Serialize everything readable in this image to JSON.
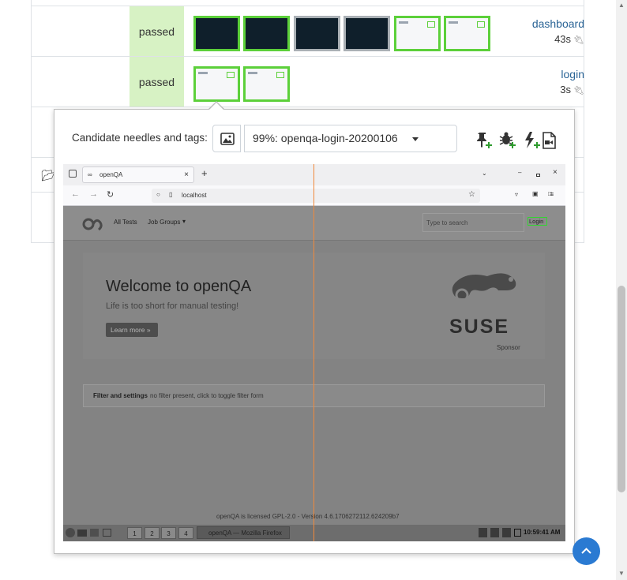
{
  "modules": [
    {
      "name": "dashboard",
      "time": "43s",
      "result": "passed",
      "thumbs": [
        {
          "variant": "dark",
          "border": "green"
        },
        {
          "variant": "dark",
          "border": "green"
        },
        {
          "variant": "dark",
          "border": "gray"
        },
        {
          "variant": "dark",
          "border": "gray"
        },
        {
          "variant": "light",
          "border": "green"
        },
        {
          "variant": "light",
          "border": "green"
        }
      ]
    },
    {
      "name": "login",
      "time": "3s",
      "result": "passed",
      "thumbs": [
        {
          "variant": "light",
          "border": "green"
        },
        {
          "variant": "light",
          "border": "green"
        }
      ]
    }
  ],
  "popover": {
    "candidate_label": "Candidate needles and tags:",
    "selected_needle": "99%: openqa-login-20200106"
  },
  "screenshot": {
    "tab_title": "openQA",
    "url": "localhost",
    "nav_all_tests": "All Tests",
    "nav_job_groups": "Job Groups",
    "search_placeholder": "Type to search",
    "login": "Login",
    "welcome_title": "Welcome to openQA",
    "welcome_subtitle": "Life is too short for manual testing!",
    "learn_more": "Learn more »",
    "suse": "SUSE",
    "sponsor": "Sponsor",
    "filter_bold": "Filter and settings",
    "filter_rest": "no filter present, click to toggle filter form",
    "license": "openQA is licensed GPL-2.0 - Version 4.6.1706272112.624209b7",
    "taskbar_window": "openQA — Mozilla Firefox",
    "clock": "10:59:41 AM",
    "workspaces": [
      "1",
      "2",
      "3",
      "4"
    ]
  },
  "colors": {
    "passed_bg": "#d7f2c4",
    "needle_match": "#5cd03a",
    "link": "#2a6496",
    "accent": "#2a7ad2"
  }
}
